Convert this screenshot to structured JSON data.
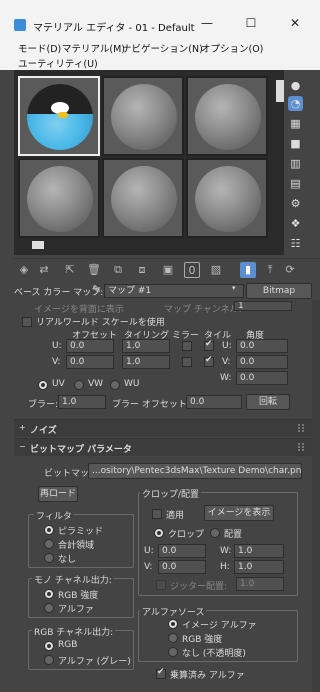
{
  "window": {
    "title": "マテリアル エディタ - 01 - Default",
    "minimize_glyph": "—",
    "maximize_glyph": "☐",
    "close_glyph": "✕"
  },
  "menu": [
    "モード(D)",
    "マテリアル(M)",
    "ナビゲーション(N)",
    "オプション(O)",
    "ユーティリティ(U)"
  ],
  "slot_toolbar_icons": [
    "get-material-icon",
    "put-material-icon",
    "assign-material-icon",
    "reset-icon",
    "make-copy-icon",
    "make-unique-icon",
    "put-library-icon",
    "material-id-icon",
    "show-map-icon",
    "show-end-result-icon",
    "go-parent-icon",
    "go-sibling-icon"
  ],
  "side_tools_icons": [
    "sample-type-icon",
    "backlight-icon",
    "background-icon",
    "uv-tiling-icon",
    "video-check-icon",
    "make-preview-icon",
    "options-icon",
    "select-by-material-icon",
    "material-map-navigator-icon"
  ],
  "namebar": {
    "label": "ベース カラー マップ:",
    "map_name": "マップ #1",
    "map_type": "Bitmap"
  },
  "coordinates": {
    "cut_row_left": "マップ チャンネル:",
    "cut_row_left_text": "イメージを背面に表示",
    "cut_row_value": "1",
    "realworld_label": "リアルワールド スケールを使用",
    "headers": {
      "offset": "オフセット",
      "tiling": "タイリング",
      "mirror": "ミラー",
      "tile": "タイル",
      "angle": "角度"
    },
    "u_label": "U:",
    "v_label": "V:",
    "w_label": "W:",
    "u_offset": "0.0",
    "v_offset": "0.0",
    "u_tiling": "1.0",
    "v_tiling": "1.0",
    "u_angle": "0.0",
    "v_angle": "0.0",
    "w_angle": "0.0",
    "uv": "UV",
    "vw": "VW",
    "wu": "WU",
    "blur_label": "ブラー:",
    "blur": "1.0",
    "blur_offset_label": "ブラー オフセット:",
    "blur_offset": "0.0",
    "rotate_button": "回転"
  },
  "rollouts": {
    "noise": "ノイズ",
    "bitmap_params": "ビットマップ パラメータ",
    "noise_sign": "+",
    "bitmap_sign": "−"
  },
  "bitmap": {
    "bitmap_label": "ビットマップ:",
    "bitmap_path": "...ository\\Pentec3dsMax\\Texture Demo\\char.png",
    "reload": "再ロード",
    "filter_title": "フィルタ",
    "filter_options": [
      "ピラミッド",
      "合計領域",
      "なし"
    ],
    "mono_title": "モノ チャネル出力:",
    "mono_options": [
      "RGB 強度",
      "アルファ"
    ],
    "rgb_title": "RGB チャネル出力:",
    "rgb_options": [
      "RGB",
      "アルファ (グレー)"
    ],
    "crop_title": "クロップ/配置",
    "apply": "適用",
    "show_image": "イメージを表示",
    "crop": "クロップ",
    "place": "配置",
    "u_val": "0.0",
    "v_val": "0.0",
    "w_val": "1.0",
    "h_val": "1.0",
    "jitter_label": "ジッター配置:",
    "jitter_val": "1.0",
    "alpha_title": "アルファソース",
    "alpha_options": [
      "イメージ アルファ",
      "RGB 強度",
      "なし (不透明度)"
    ],
    "premult": "乗算済み アルファ",
    "u_label": "U:",
    "v_label": "V:",
    "w_label": "W:",
    "h_label": "H:"
  }
}
